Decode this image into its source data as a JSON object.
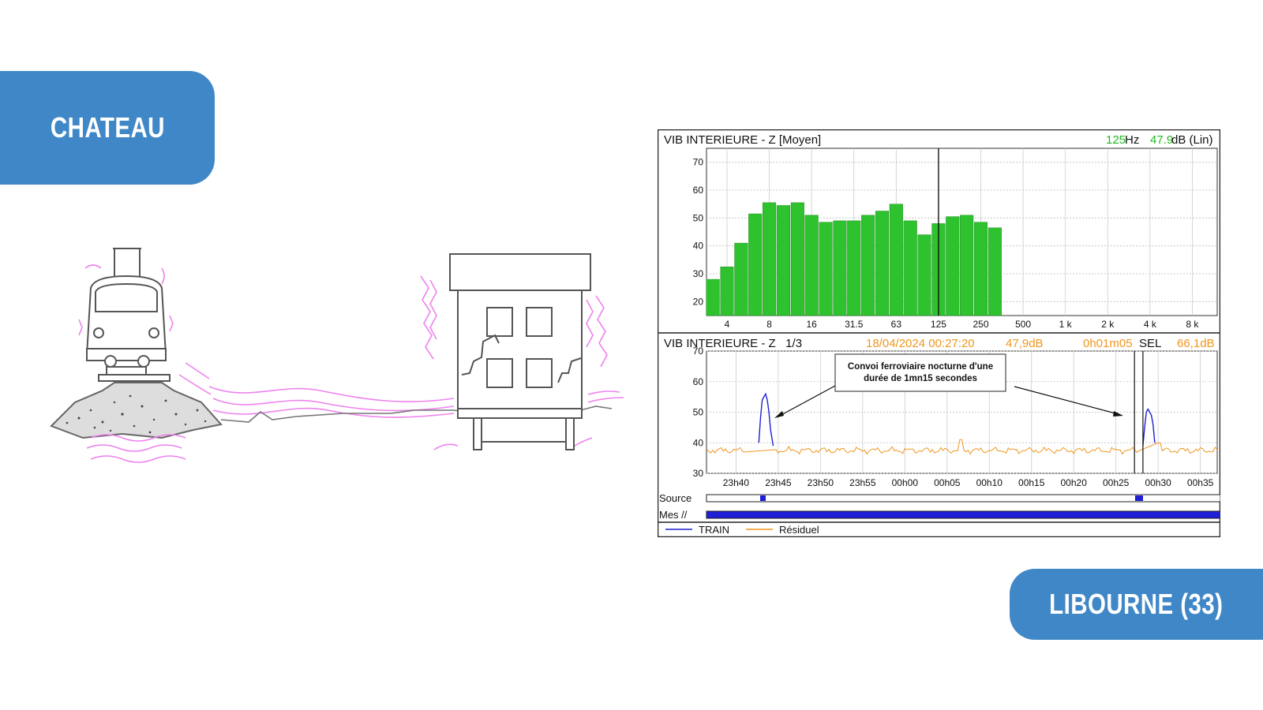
{
  "badges": {
    "left": "CHATEAU",
    "right": "LIBOURNE (33)"
  },
  "colors": {
    "badge_bg": "#3f87c7",
    "bar_fill": "#2ec22e",
    "train": "#1f1fd6",
    "residuel": "#f0961e",
    "highlight": "#f0961e",
    "green_value": "#22b822",
    "vibration_lines": "#ee82ee"
  },
  "illustration": {
    "left_icon": "train-on-ballast-icon",
    "right_icon": "cracked-building-icon"
  },
  "chart_data": [
    {
      "type": "bar",
      "title": "VIB INTERIEURE - Z [Moyen]",
      "readout": {
        "freq_value": "125",
        "freq_unit": "Hz",
        "level_value": "47.9",
        "level_unit": "dB (Lin)"
      },
      "categories": [
        "4",
        "5",
        "6.3",
        "8",
        "10",
        "12.5",
        "16",
        "20",
        "25",
        "31.5",
        "40",
        "50",
        "63",
        "80",
        "100",
        "125",
        "160",
        "200",
        "250",
        "315"
      ],
      "values": [
        28,
        32.5,
        41,
        51.5,
        55.5,
        54.5,
        55.5,
        51,
        48.5,
        49,
        49,
        51,
        52.5,
        55,
        49,
        44,
        48,
        50.5,
        51,
        48.5,
        46.5
      ],
      "x_ticks": [
        "4",
        "8",
        "16",
        "31.5",
        "63",
        "125",
        "250",
        "500",
        "1 k",
        "2 k",
        "4 k",
        "8 k"
      ],
      "y_ticks": [
        20,
        30,
        40,
        50,
        60,
        70
      ],
      "ylim": [
        15,
        75
      ],
      "cursor": "125",
      "grid": true
    },
    {
      "type": "line",
      "title": "VIB INTERIEURE - Z   1/3",
      "header": {
        "datetime": "18/04/2024 00:27:20",
        "level": "47,9dB",
        "duration": "0h01m05",
        "sel_label": "SEL",
        "sel_value": "66,1dB"
      },
      "x_ticks": [
        "23h40",
        "23h45",
        "23h50",
        "23h55",
        "00h00",
        "00h05",
        "00h10",
        "00h15",
        "00h20",
        "00h25",
        "00h30",
        "00h35"
      ],
      "y_ticks": [
        30,
        40,
        50,
        60,
        70
      ],
      "ylim": [
        30,
        70
      ],
      "xlim_minutes": [
        -23.5,
        37
      ],
      "series": [
        {
          "name": "TRAIN",
          "x": [
            -17.3,
            -17.1,
            -16.9,
            -16.7,
            -16.5,
            -16.3,
            -16.1,
            -15.9,
            -15.6
          ],
          "y": [
            40,
            48,
            54,
            55,
            56,
            54,
            50,
            44,
            39
          ],
          "x2": [
            28.2,
            28.4,
            28.6,
            28.8,
            29.0,
            29.2,
            29.4,
            29.6
          ],
          "y2": [
            39,
            45,
            50,
            51,
            50,
            49,
            46,
            40
          ]
        },
        {
          "name": "Résiduel",
          "base": 37.5
        }
      ],
      "annotation": {
        "line1": "Convoi ferroviaire nocturne d'une",
        "line2": "durée de 1mn15 secondes"
      },
      "tracks": {
        "source_label": "Source",
        "mes_label": "Mes //"
      },
      "legend": [
        {
          "name": "TRAIN"
        },
        {
          "name": "Résiduel"
        }
      ],
      "grid": true
    }
  ]
}
